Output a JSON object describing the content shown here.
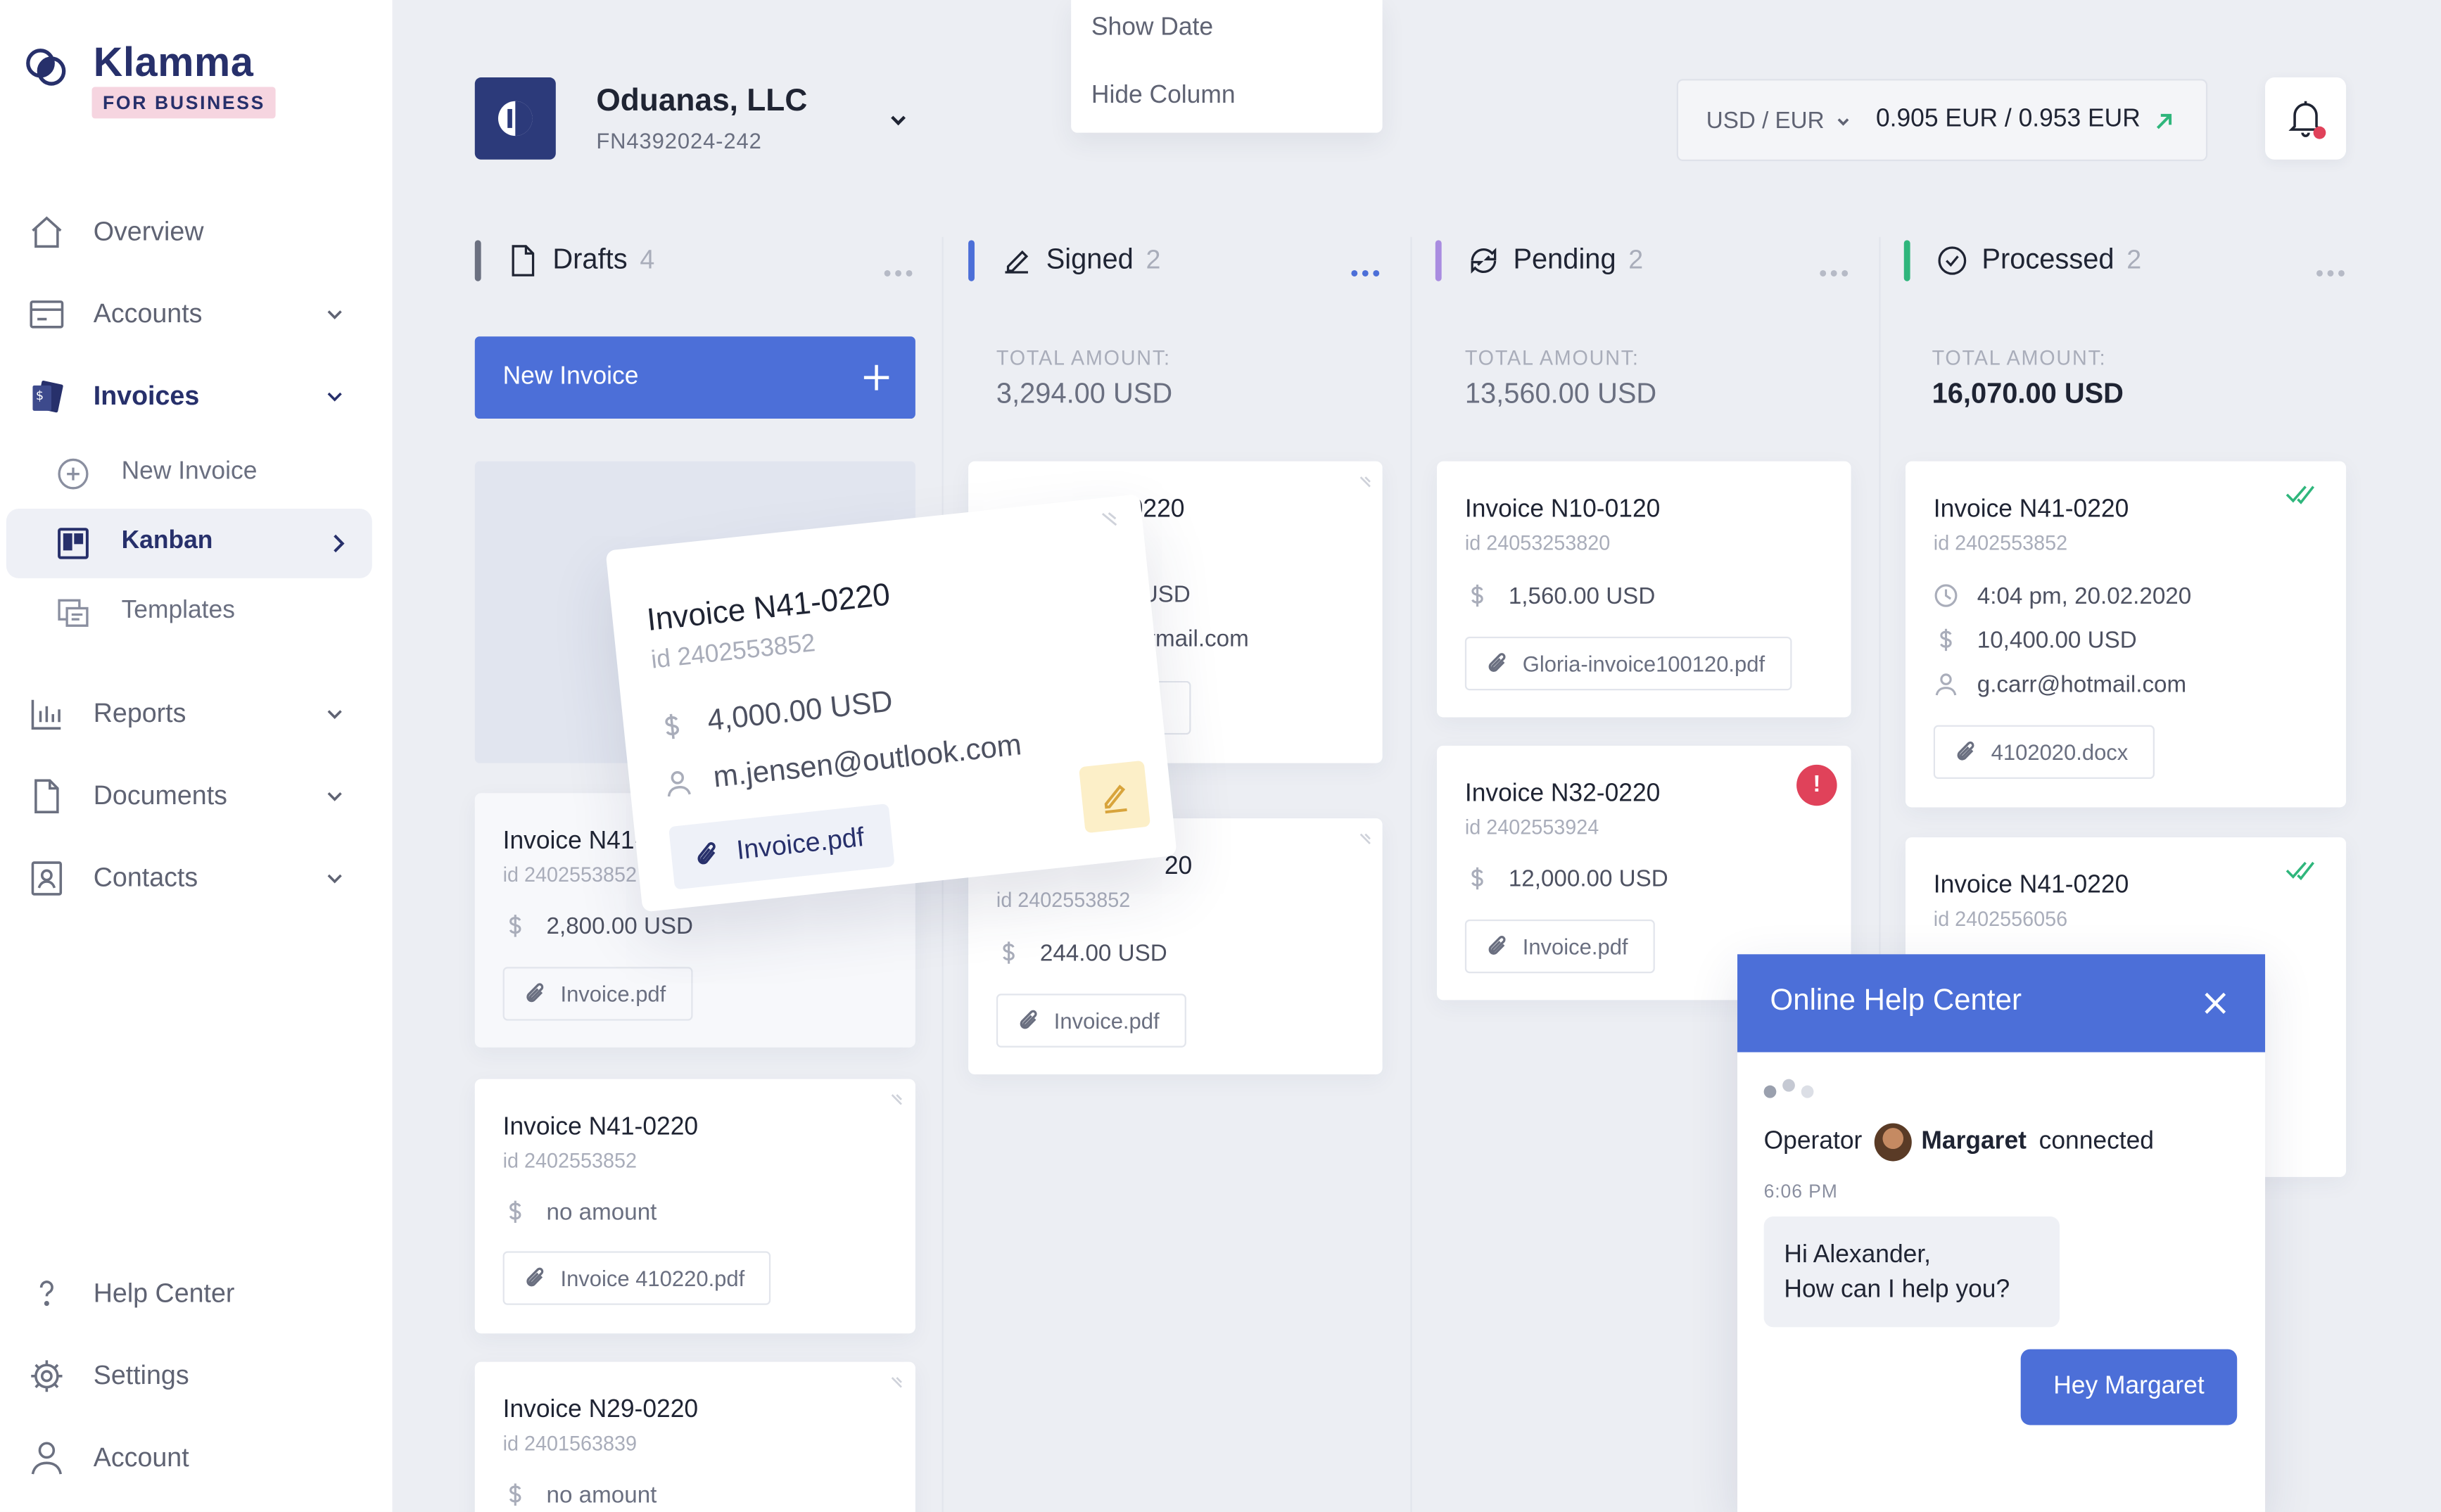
{
  "brand": {
    "name": "Klamma",
    "badge": "FOR BUSINESS"
  },
  "nav": {
    "overview": "Overview",
    "accounts": "Accounts",
    "invoices": "Invoices",
    "sub": {
      "new_invoice": "New Invoice",
      "kanban": "Kanban",
      "templates": "Templates"
    },
    "reports": "Reports",
    "documents": "Documents",
    "contacts": "Contacts",
    "help_center": "Help Center",
    "settings": "Settings",
    "account": "Account"
  },
  "company": {
    "name": "Oduanas, LLC",
    "id": "FN4392024-242"
  },
  "column_menu": {
    "show_date": "Show Date",
    "hide_column": "Hide Column"
  },
  "currency": {
    "pair_from": "USD",
    "pair_sep": "/",
    "pair_to": "EUR",
    "rate": "0.905 EUR / 0.953 EUR"
  },
  "colors": {
    "accent": "#4c6fd8",
    "brand": "#27306b",
    "signed": "#4c6fd8",
    "pending": "#a98ce0",
    "processed": "#2fb67c",
    "drafts": "#6b7080",
    "alert": "#e0425a"
  },
  "columns": {
    "drafts": {
      "title": "Drafts",
      "count": "4",
      "new_invoice": "New Invoice"
    },
    "signed": {
      "title": "Signed",
      "count": "2",
      "total_label": "TOTAL AMOUNT:",
      "total": "3,294.00 USD"
    },
    "pending": {
      "title": "Pending",
      "count": "2",
      "total_label": "TOTAL AMOUNT:",
      "total": "13,560.00 USD"
    },
    "processed": {
      "title": "Processed",
      "count": "2",
      "total_label": "TOTAL AMOUNT:",
      "total": "16,070.00 USD"
    }
  },
  "cards": {
    "drafts": [
      {
        "title": "Invoice N41-",
        "id": "id 2402553852",
        "amount": "2,800.00 USD",
        "file": "Invoice.pdf"
      },
      {
        "title": "Invoice N41-0220",
        "id": "id 2402553852",
        "amount": "no amount",
        "file": "Invoice 410220.pdf"
      },
      {
        "title": "Invoice N29-0220",
        "id": "id 2401563839",
        "amount": "no amount"
      }
    ],
    "signed": [
      {
        "title": "-0220",
        "amount": "USD",
        "email": "tmail.com",
        "file": "f"
      },
      {
        "title": "20",
        "id": "id 2402553852",
        "amount": "244.00 USD",
        "file": "Invoice.pdf"
      }
    ],
    "pending": [
      {
        "title": "Invoice N10-0120",
        "id": "id 24053253820",
        "amount": "1,560.00 USD",
        "file": "Gloria-invoice100120.pdf"
      },
      {
        "title": "Invoice N32-0220",
        "id": "id 2402553924",
        "amount": "12,000.00 USD",
        "file": "Invoice.pdf",
        "alert": "!"
      }
    ],
    "processed": [
      {
        "title": "Invoice N41-0220",
        "id": "id 2402553852",
        "date": "4:04 pm, 20.02.2020",
        "amount": "10,400.00 USD",
        "email": "g.carr@hotmail.com",
        "file": "4102020.docx"
      },
      {
        "title": "Invoice N41-0220",
        "id": "id 2402556056"
      }
    ]
  },
  "dragged_card": {
    "title": "Invoice N41-0220",
    "id": "id 2402553852",
    "amount": "4,000.00 USD",
    "email": "m.jensen@outlook.com",
    "file": "Invoice.pdf"
  },
  "help": {
    "title": "Online Help Center",
    "operator_label": "Operator",
    "operator_name": "Margaret",
    "status": "connected",
    "time": "6:06 PM",
    "message_in_1": "Hi Alexander,",
    "message_in_2": "How can I help you?",
    "message_out": "Hey Margaret"
  }
}
